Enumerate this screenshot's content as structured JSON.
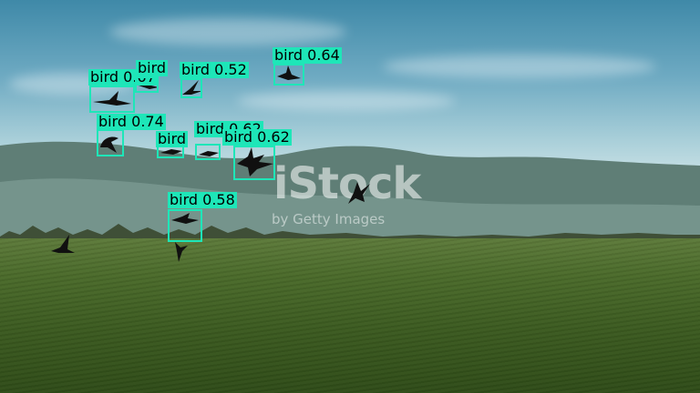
{
  "watermark": {
    "main": "iStock",
    "sub": "by Getty Images"
  },
  "detections": [
    {
      "label": "bird",
      "score": "0.67"
    },
    {
      "label": "bird",
      "score": "0.52"
    },
    {
      "label": "bird",
      "score": "0.64"
    },
    {
      "label": "bird",
      "score": "0.74"
    },
    {
      "label": "bird",
      "score": "0.62"
    },
    {
      "label": "bird",
      "score": "0.62"
    },
    {
      "label": "bird",
      "score": "0.58"
    },
    {
      "label": "bird",
      "score": ""
    }
  ],
  "colors": {
    "box": "#1ee6b8",
    "label_text": "#000000"
  }
}
